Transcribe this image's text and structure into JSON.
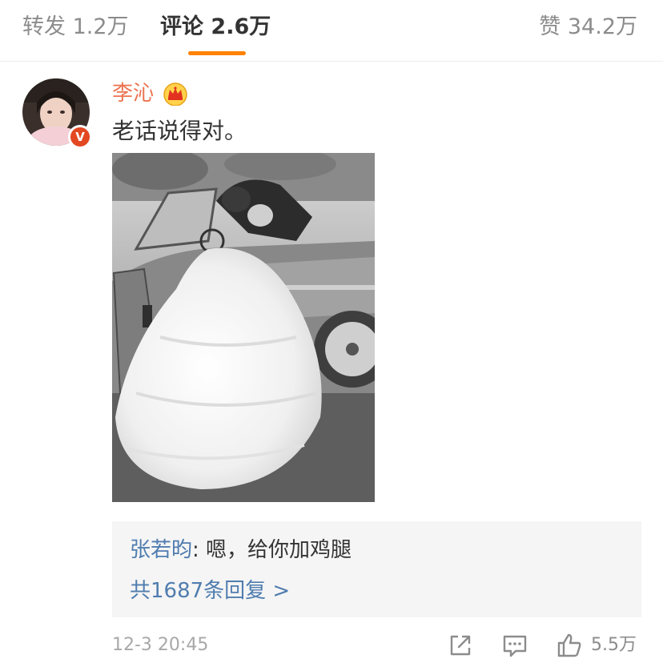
{
  "tabs": {
    "repost": {
      "label": "转发",
      "count": "1.2万"
    },
    "comment": {
      "label": "评论",
      "count": "2.6万"
    },
    "like": {
      "label": "赞",
      "count": "34.2万"
    }
  },
  "comment": {
    "username": "李沁",
    "verified_badge": "V",
    "text": "老话说得对。",
    "image_icon": "wedding-photo",
    "timestamp": "12-3 20:45",
    "like_count": "5.5万"
  },
  "reply_preview": {
    "author": "张若昀",
    "separator": ": ",
    "text": "嗯，给你加鸡腿",
    "more_label": "共1687条回复 >"
  },
  "icons": [
    "crown-icon",
    "share-icon",
    "reply-icon",
    "thumbs-up-icon"
  ],
  "colors": {
    "accent": "#ff8200",
    "username": "#eb7350",
    "link": "#507daf",
    "verified": "#e24822"
  }
}
